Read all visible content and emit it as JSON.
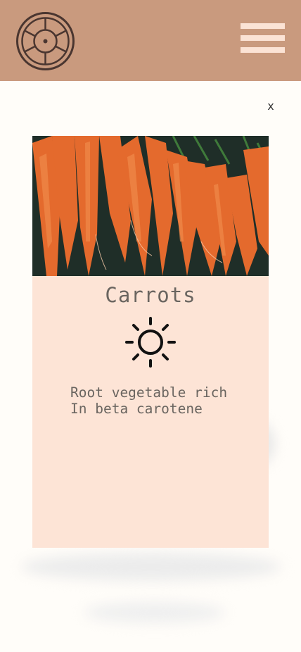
{
  "header": {
    "logo_icon": "ship-wheel-icon",
    "menu_icon": "hamburger-menu-icon",
    "background_color": "#c99a7e",
    "menu_color": "#fbe3d5"
  },
  "modal": {
    "close_label": "x",
    "title": "Carrots",
    "weather_icon": "sun-icon",
    "description": "Root vegetable rich\nIn beta carotene",
    "card_color": "#fde4d6"
  }
}
